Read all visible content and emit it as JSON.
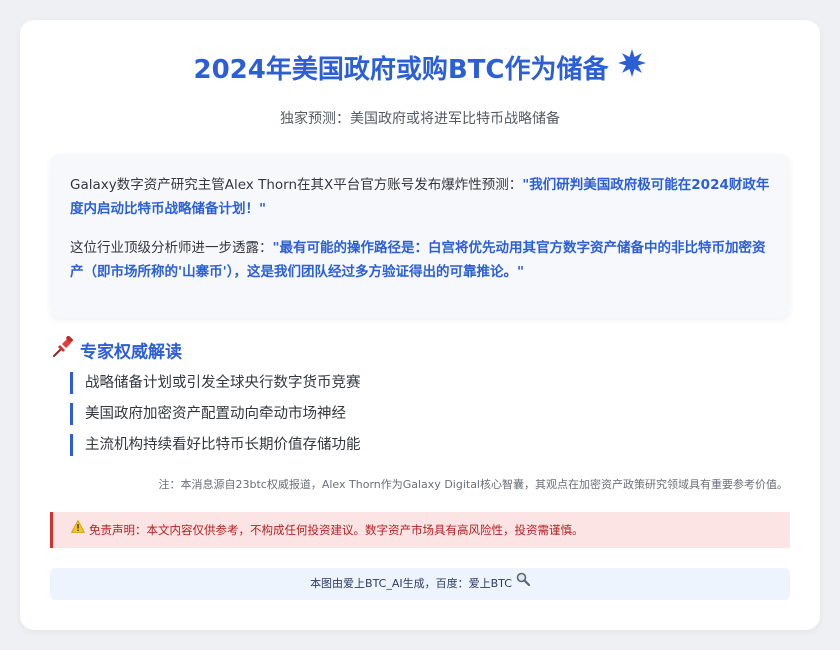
{
  "header": {
    "title": "2024年美国政府或购BTC作为储备",
    "title_icon": "sparkle-burst-icon",
    "subtitle": "独家预测：美国政府或将进军比特币战略储备"
  },
  "quote_box": {
    "p1_text": "Galaxy数字资产研究主管Alex Thorn在其X平台官方账号发布爆炸性预测：",
    "p1_quote": "\"我们研判美国政府极可能在2024财政年度内启动比特币战略储备计划！\"",
    "p2_text": "这位行业顶级分析师进一步透露：",
    "p2_quote": "\"最有可能的操作路径是：白宫将优先动用其官方数字资产储备中的非比特币加密资产（即市场所称的'山寨币'），这是我们团队经过多方验证得出的可靠推论。\""
  },
  "expert": {
    "icon": "pushpin-icon",
    "title": "专家权威解读",
    "points": [
      "战略储备计划或引发全球央行数字货币竞赛",
      "美国政府加密资产配置动向牵动市场神经",
      "主流机构持续看好比特币长期价值存储功能"
    ]
  },
  "note": "注：本消息源自23btc权威报道，Alex Thorn作为Galaxy Digital核心智囊，其观点在加密资产政策研究领域具有重要参考价值。",
  "disclaimer": {
    "icon": "warning-icon",
    "text": "免责声明：本文内容仅供参考，不构成任何投资建议。数字资产市场具有高风险性，投资需谨慎。"
  },
  "footer": {
    "text": "本图由爱上BTC_AI生成，百度：爱上BTC",
    "icon": "magnifier-icon"
  },
  "colors": {
    "accent": "#2c5fd6",
    "danger": "#d63131",
    "danger_bg": "#fde4e4"
  }
}
